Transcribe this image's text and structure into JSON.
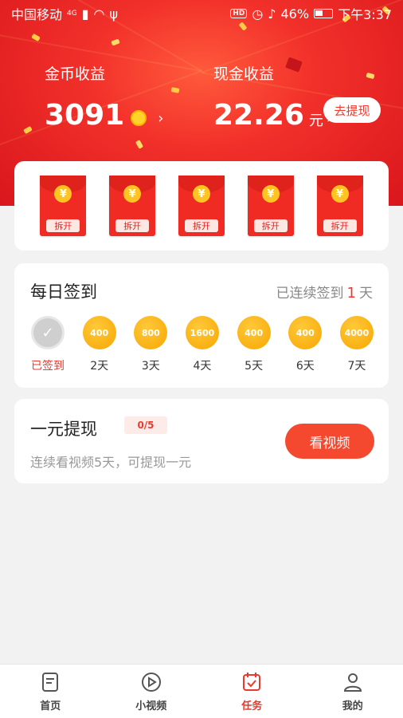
{
  "status_bar": {
    "carrier": "中国移动",
    "network": "4G",
    "battery": "46%",
    "time": "下午3:37"
  },
  "earnings": {
    "coins_label": "金币收益",
    "coins_value": "3091",
    "cash_label": "现金收益",
    "cash_value": "22.26",
    "cash_unit": "元",
    "withdraw_label": "去提现"
  },
  "envelopes": [
    {
      "symbol": "¥",
      "label": "拆开"
    },
    {
      "symbol": "¥",
      "label": "拆开"
    },
    {
      "symbol": "¥",
      "label": "拆开"
    },
    {
      "symbol": "¥",
      "label": "拆开"
    },
    {
      "symbol": "¥",
      "label": "拆开"
    }
  ],
  "signin": {
    "title": "每日签到",
    "streak_prefix": "已连续签到",
    "streak_days": "1",
    "streak_suffix": "天",
    "days": [
      {
        "reward": "",
        "label": "已签到",
        "checked": true
      },
      {
        "reward": "400",
        "label": "2天"
      },
      {
        "reward": "800",
        "label": "3天"
      },
      {
        "reward": "1600",
        "label": "4天"
      },
      {
        "reward": "400",
        "label": "5天"
      },
      {
        "reward": "400",
        "label": "6天"
      },
      {
        "reward": "4000",
        "label": "7天"
      }
    ]
  },
  "one_yuan": {
    "title": "一元提现",
    "progress": "0/5",
    "description": "连续看视频5天，可提现一元",
    "button": "看视频"
  },
  "tabs": [
    {
      "label": "首页",
      "icon": "home-icon"
    },
    {
      "label": "小视频",
      "icon": "video-icon"
    },
    {
      "label": "任务",
      "icon": "task-icon",
      "active": true
    },
    {
      "label": "我的",
      "icon": "profile-icon"
    }
  ],
  "colors": {
    "accent": "#e63b2e",
    "hero": "#f2302a",
    "gold": "#f7a600"
  }
}
